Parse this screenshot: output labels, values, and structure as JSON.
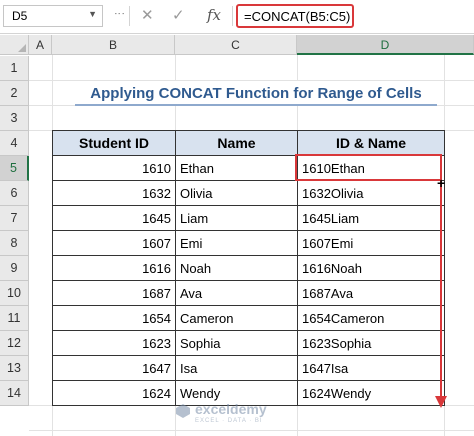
{
  "formula_bar": {
    "name_box": "D5",
    "cancel_icon": "close-icon",
    "enter_icon": "check-icon",
    "function_icon": "fx",
    "formula": "=CONCAT(B5:C5)"
  },
  "columns": [
    "A",
    "B",
    "C",
    "D"
  ],
  "rows": [
    "1",
    "2",
    "3",
    "4",
    "5",
    "6",
    "7",
    "8",
    "9",
    "10",
    "11",
    "12",
    "13",
    "14"
  ],
  "selected_cell": "D5",
  "sheet": {
    "title": "Applying CONCAT Function for Range of Cells",
    "headers": [
      "Student ID",
      "Name",
      "ID & Name"
    ],
    "records": [
      {
        "id": "1610",
        "name": "Ethan",
        "combined": "1610Ethan"
      },
      {
        "id": "1632",
        "name": "Olivia",
        "combined": "1632Olivia"
      },
      {
        "id": "1645",
        "name": "Liam",
        "combined": "1645Liam"
      },
      {
        "id": "1607",
        "name": "Emi",
        "combined": "1607Emi"
      },
      {
        "id": "1616",
        "name": "Noah",
        "combined": "1616Noah"
      },
      {
        "id": "1687",
        "name": "Ava",
        "combined": "1687Ava"
      },
      {
        "id": "1654",
        "name": "Cameron",
        "combined": "1654Cameron"
      },
      {
        "id": "1623",
        "name": "Sophia",
        "combined": "1623Sophia"
      },
      {
        "id": "1647",
        "name": "Isa",
        "combined": "1647Isa"
      },
      {
        "id": "1624",
        "name": "Wendy",
        "combined": "1624Wendy"
      }
    ]
  },
  "watermark": {
    "name": "exceldemy",
    "tagline": "EXCEL · DATA · BI"
  },
  "colors": {
    "highlight": "#d9383a",
    "header_fill": "#d8e2ef",
    "title_text": "#2f5a8f",
    "selection_green": "#217346"
  }
}
